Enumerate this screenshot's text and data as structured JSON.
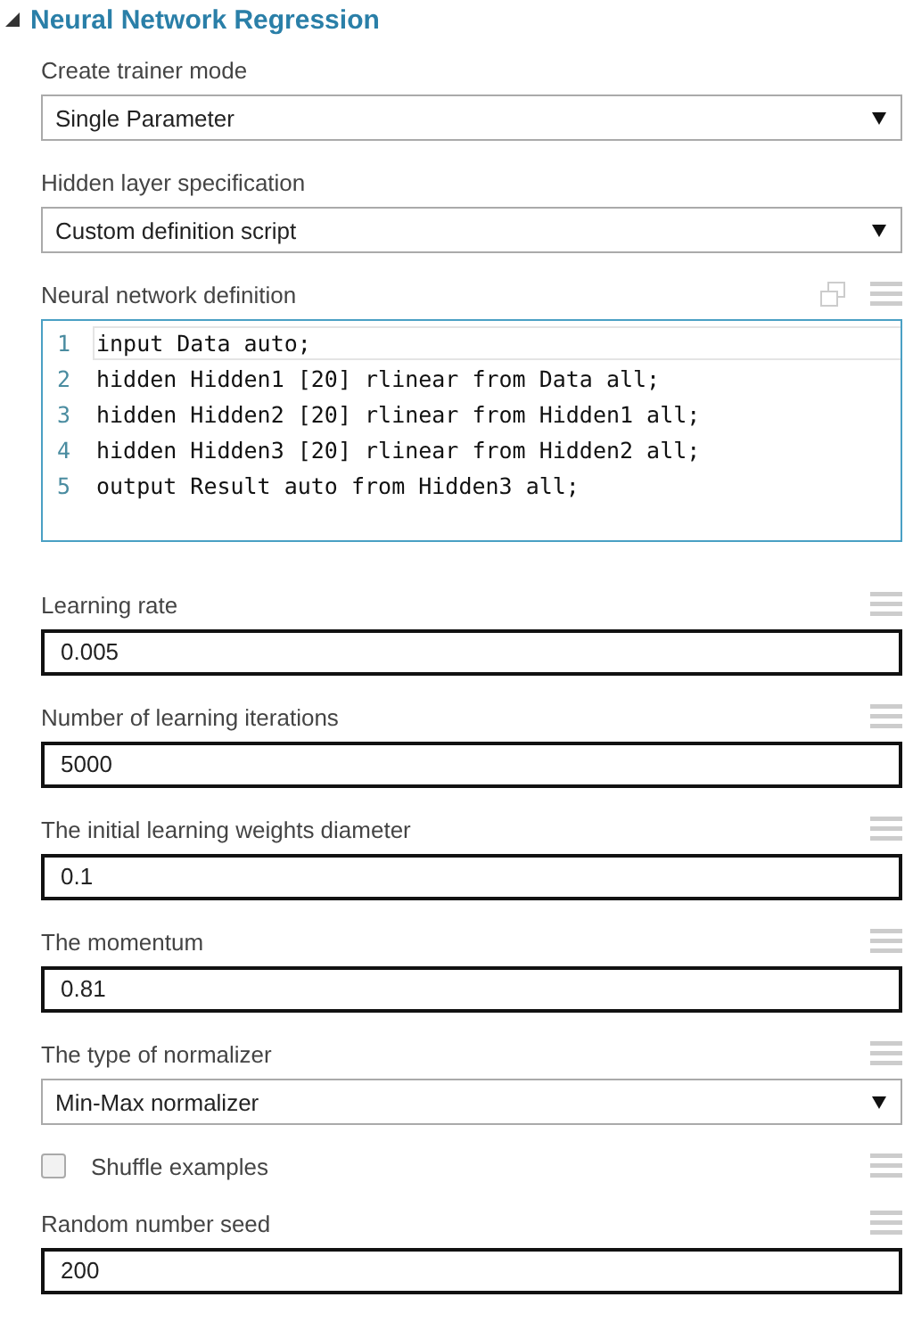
{
  "section": {
    "title": "Neural Network Regression",
    "expanded": true
  },
  "params": [
    {
      "kind": "select",
      "label": "Create trainer mode",
      "value": "Single Parameter",
      "menu_icon": false
    },
    {
      "kind": "select",
      "label": "Hidden layer specification",
      "value": "Custom definition script",
      "menu_icon": false
    },
    {
      "kind": "code",
      "label": "Neural network definition",
      "menu_icon": true,
      "lines": [
        {
          "number": "1",
          "text": "input Data auto;",
          "active": true
        },
        {
          "number": "2",
          "text": "hidden Hidden1 [20] rlinear from Data all;",
          "active": false
        },
        {
          "number": "3",
          "text": "hidden Hidden2 [20] rlinear from Hidden1 all;",
          "active": false
        },
        {
          "number": "4",
          "text": "hidden Hidden3 [20] rlinear from Hidden2 all;",
          "active": false
        },
        {
          "number": "5",
          "text": "output Result auto from Hidden3 all;",
          "active": false
        }
      ]
    },
    {
      "kind": "text",
      "label": "Learning rate",
      "value": "0.005",
      "menu_icon": true
    },
    {
      "kind": "text",
      "label": "Number of learning iterations",
      "value": "5000",
      "menu_icon": true
    },
    {
      "kind": "text",
      "label": "The initial learning weights diameter",
      "value": "0.1",
      "menu_icon": true
    },
    {
      "kind": "text",
      "label": "The momentum",
      "value": "0.81",
      "menu_icon": true
    },
    {
      "kind": "select",
      "label": "The type of normalizer",
      "value": "Min-Max normalizer",
      "menu_icon": true
    },
    {
      "kind": "checkbox",
      "label": "Shuffle examples",
      "checked": false,
      "menu_icon": true
    },
    {
      "kind": "text",
      "label": "Random number seed",
      "value": "200",
      "menu_icon": true
    }
  ]
}
